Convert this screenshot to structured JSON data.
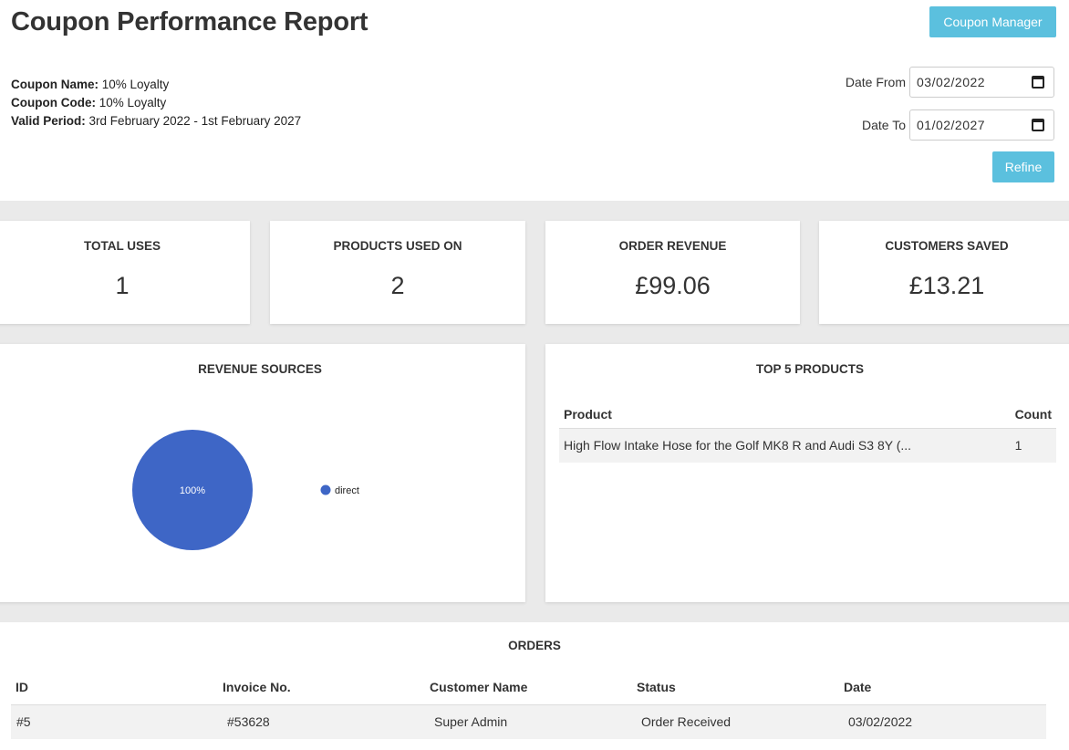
{
  "header": {
    "title": "Coupon Performance Report",
    "coupon_manager_label": "Coupon Manager",
    "refine_label": "Refine"
  },
  "coupon": {
    "name_label": "Coupon Name:",
    "name_value": "10% Loyalty",
    "code_label": "Coupon Code:",
    "code_value": "10% Loyalty",
    "period_label": "Valid Period:",
    "period_value": "3rd February 2022 - 1st February 2027"
  },
  "filters": {
    "date_from_label": "Date From",
    "date_from_value": "03/02/2022",
    "date_to_label": "Date To",
    "date_to_value": "01/02/2027"
  },
  "stats": [
    {
      "title": "TOTAL USES",
      "value": "1"
    },
    {
      "title": "PRODUCTS USED ON",
      "value": "2"
    },
    {
      "title": "ORDER REVENUE",
      "value": "£99.06"
    },
    {
      "title": "CUSTOMERS SAVED",
      "value": "£13.21"
    }
  ],
  "revenue_sources": {
    "title": "REVENUE SOURCES",
    "chart_data": {
      "type": "pie",
      "slices": [
        {
          "label": "direct",
          "value": 100,
          "display": "100%",
          "color": "#3e66c6"
        }
      ],
      "legend": "right"
    }
  },
  "top_products": {
    "title": "TOP 5 PRODUCTS",
    "columns": [
      "Product",
      "Count"
    ],
    "rows": [
      {
        "product": "High Flow Intake Hose for the Golf MK8 R and Audi S3 8Y (...",
        "count": "1"
      }
    ]
  },
  "orders": {
    "title": "ORDERS",
    "columns": [
      "ID",
      "Invoice No.",
      "Customer Name",
      "Status",
      "Date"
    ],
    "rows": [
      {
        "id": "#5",
        "invoice": "#53628",
        "customer": "Super Admin",
        "status": "Order Received",
        "date": "03/02/2022"
      }
    ]
  },
  "colors": {
    "accent": "#5bc0de",
    "pie": "#3e66c6",
    "background": "#eaeaea"
  }
}
